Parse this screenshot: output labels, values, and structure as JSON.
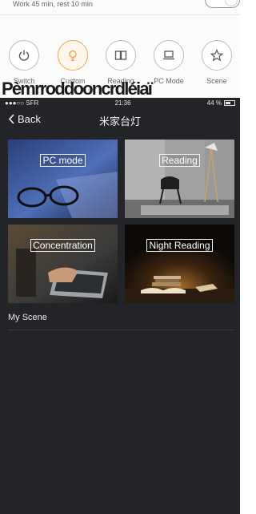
{
  "background_app": {
    "work_status": "Work 45 min, rest 10 min",
    "modes": [
      {
        "label": "Switch",
        "icon": "power-icon"
      },
      {
        "label": "Custom",
        "icon": "bulb-icon"
      },
      {
        "label": "Reading",
        "icon": "book-icon"
      },
      {
        "label": "PC Mode",
        "icon": "laptop-icon"
      },
      {
        "label": "Scene",
        "icon": "star-icon"
      }
    ],
    "garbled_overlay_text": "Pèmrroddooncrdléiaï"
  },
  "status_bar": {
    "carrier": "●●●○○ SFR",
    "wifi_icon": "wifi-icon",
    "time": "21:36",
    "battery_percent": "44 %"
  },
  "nav": {
    "back_label": "Back",
    "title": "米家台灯"
  },
  "scenes": [
    {
      "label": "PC mode"
    },
    {
      "label": "Reading"
    },
    {
      "label": "Concentration"
    },
    {
      "label": "Night Reading"
    }
  ],
  "my_scene": {
    "label": "My Scene"
  },
  "colors": {
    "accent_orange": "#f0a450",
    "dark_bg": "#232427"
  }
}
